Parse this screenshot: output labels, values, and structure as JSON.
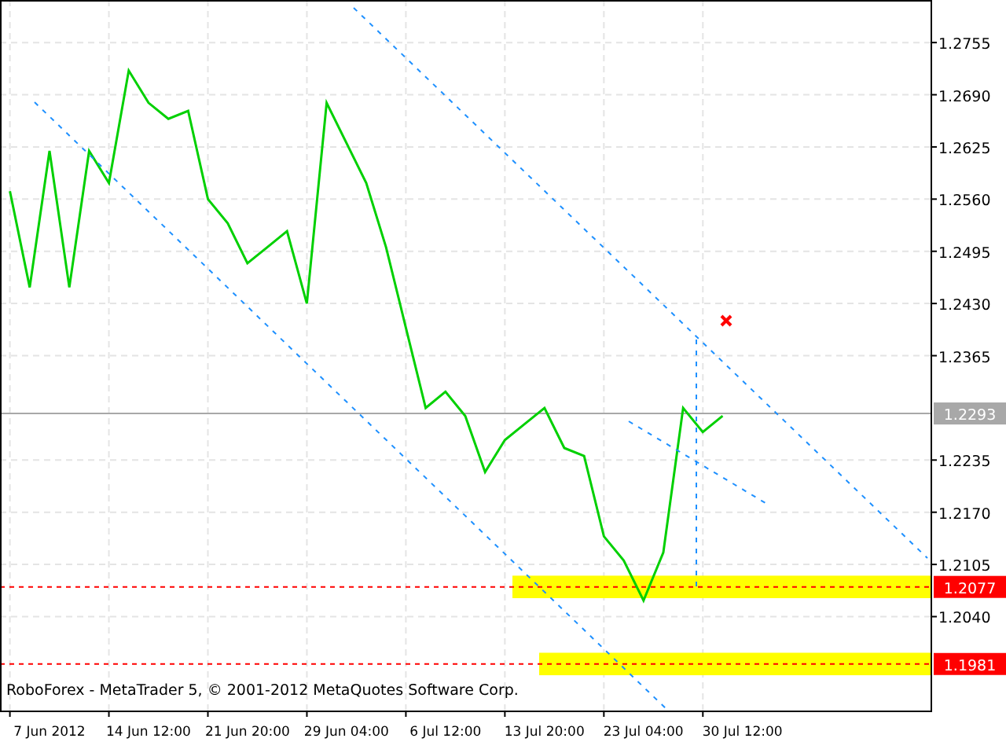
{
  "chart_data": {
    "type": "line",
    "grid": true,
    "categories": [
      null,
      null,
      "7 Jun 2012",
      null,
      null,
      null,
      null,
      "14 Jun 12:00",
      null,
      null,
      null,
      null,
      "21 Jun 20:00",
      null,
      null,
      null,
      null,
      "29 Jun 04:00",
      null,
      null,
      null,
      null,
      "6 Jul 12:00",
      null,
      null,
      null,
      null,
      "13 Jul 20:00",
      null,
      null,
      null,
      null,
      "23 Jul 04:00",
      null,
      null,
      null,
      null,
      "30 Jul 12:00",
      null,
      null,
      null,
      null,
      null,
      null,
      null,
      null,
      null
    ],
    "series": [
      {
        "color": "#00d000",
        "values": [
          1.257,
          1.245,
          1.262,
          1.245,
          1.262,
          1.258,
          1.272,
          1.268,
          1.266,
          1.267,
          1.256,
          1.253,
          1.248,
          1.25,
          1.252,
          1.243,
          1.268,
          1.263,
          1.258,
          1.25,
          1.24,
          1.23,
          1.232,
          1.229,
          1.222,
          1.226,
          1.228,
          1.23,
          1.225,
          1.224,
          1.214,
          1.211,
          1.206,
          1.212,
          1.23,
          1.227,
          1.229,
          null,
          null,
          null,
          null,
          null,
          null,
          null,
          null,
          null,
          null
        ]
      }
    ],
    "ylim": [
      1.1923,
      1.2808
    ],
    "yticks": [
      {
        "value": 1.2755,
        "label": "1.2755"
      },
      {
        "value": 1.269,
        "label": "1.2690"
      },
      {
        "value": 1.2625,
        "label": "1.2625"
      },
      {
        "value": 1.256,
        "label": "1.2560"
      },
      {
        "value": 1.2495,
        "label": "1.2495"
      },
      {
        "value": 1.243,
        "label": "1.2430"
      },
      {
        "value": 1.2365,
        "label": "1.2365"
      },
      {
        "value": 1.2235,
        "label": "1.2235"
      },
      {
        "value": 1.217,
        "label": "1.2170"
      },
      {
        "value": 1.2105,
        "label": "1.2105"
      },
      {
        "value": 1.204,
        "label": "1.2040"
      }
    ],
    "ref_lines": [
      {
        "axis": "y",
        "value": 1.2293,
        "label": "1.2293",
        "color": "#a8a8a8"
      },
      {
        "axis": "y",
        "value": 1.2077,
        "label": "1.2077",
        "color": "#ff0000"
      },
      {
        "axis": "y",
        "value": 1.1981,
        "label": "1.1981",
        "color": "#ff0000"
      }
    ],
    "bands": [
      {
        "axis": "y",
        "from": 1.2063,
        "to": 1.2091,
        "color": "#ffff00"
      },
      {
        "axis": "y",
        "from": 1.1967,
        "to": 1.1995,
        "color": "#ffff00"
      }
    ]
  },
  "copyright": "RoboForex - MetaTrader 5, © 2001-2012 MetaQuotes Software Corp."
}
